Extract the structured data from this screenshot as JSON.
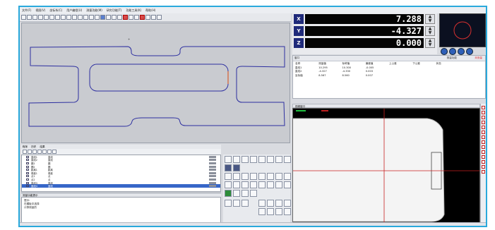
{
  "app": {
    "menu": [
      "文件(F)",
      "视图(V)",
      "坐标系(C)",
      "用户编程(U)",
      "测量功能(M)",
      "研究功能(T)",
      "功能工具(K)",
      "帮助(H)"
    ]
  },
  "coords": [
    {
      "axis": "X",
      "value": "7.288"
    },
    {
      "axis": "Y",
      "value": "-4.327"
    },
    {
      "axis": "Z",
      "value": "0.000"
    }
  ],
  "results": {
    "title": "窗口",
    "meas_label": "测量功能",
    "status": "未测量",
    "columns": [
      "名称",
      "测量值",
      "标称值",
      "偏差值",
      "上公差",
      "下公差",
      "状态",
      ""
    ],
    "rows": [
      [
        "直线1",
        "10.295",
        "10.300",
        "-0.005",
        "",
        "",
        "",
        ""
      ],
      [
        "直线2",
        "-4.327",
        "-4.330",
        "0.003",
        "",
        "",
        "",
        ""
      ],
      [
        "坐标值",
        "8.567",
        "8.560",
        "0.007",
        "",
        "",
        "",
        ""
      ]
    ]
  },
  "camera": {
    "title": "视频窗口"
  },
  "list": {
    "tabs": [
      "程序",
      "历史",
      "结果"
    ],
    "rows": [
      {
        "name": "直线1",
        "type": "直线"
      },
      {
        "name": "直线2",
        "type": "直线"
      },
      {
        "name": "圆1",
        "type": "圆"
      },
      {
        "name": "圆2",
        "type": "圆"
      },
      {
        "name": "距离1",
        "type": "距离"
      },
      {
        "name": "角度1",
        "type": "角度"
      },
      {
        "name": "点1",
        "type": "点"
      },
      {
        "name": "点2",
        "type": "点"
      },
      {
        "name": "直线3",
        "type": "直线"
      },
      {
        "name": "直线4",
        "type": "直线"
      }
    ]
  },
  "command": {
    "title": "测量功能提示",
    "lines": [
      "提示:",
      "在模板中选择",
      "计算测量的"
    ]
  },
  "status": [
    "",
    "",
    "",
    "",
    "",
    ""
  ]
}
